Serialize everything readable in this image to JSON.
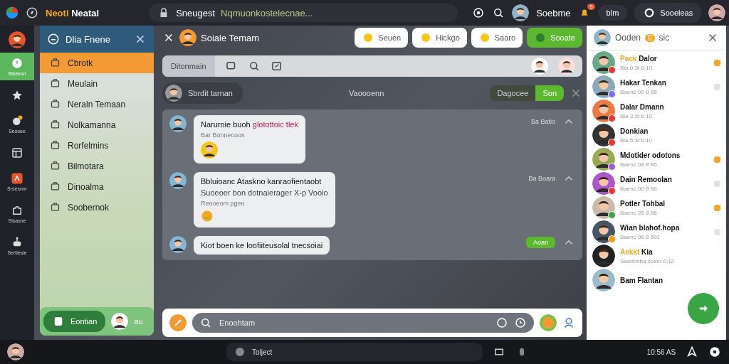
{
  "top_bar": {
    "title_accent": "Neoti",
    "title": "Neatal",
    "search": {
      "label": "Sneugest",
      "value": "Nqmuonkostelecnae..."
    },
    "user": "Soebme",
    "notification_count": "5",
    "pill": "blm",
    "settings": "Sooeleas"
  },
  "rail": {
    "items": [
      {
        "label": "Stsesnn",
        "selected": true
      },
      {
        "selected": false
      },
      {
        "label": "Sesoee",
        "selected": false
      },
      {
        "selected": false
      },
      {
        "label": "Srsesnnr",
        "selected": false
      },
      {
        "label": "Sisasne",
        "selected": false
      },
      {
        "label": "Sertiesie",
        "selected": false
      }
    ]
  },
  "left_panel": {
    "title": "Dlia Fnene",
    "items": [
      {
        "label": "Cbrotk",
        "selected": true
      },
      {
        "label": "Meulain",
        "selected": false
      },
      {
        "label": "Neraln Temaan",
        "selected": false
      },
      {
        "label": "Nolkamanna",
        "selected": false
      },
      {
        "label": "Rorfelmins",
        "selected": false
      },
      {
        "label": "Bilmotara",
        "selected": false
      },
      {
        "label": "Dinoalma",
        "selected": false
      },
      {
        "label": "Soobernok",
        "selected": false
      }
    ],
    "button": "Eontian",
    "user": "au"
  },
  "chat": {
    "title": "Soiale Temam",
    "chips": [
      {
        "label": "Seuen",
        "selected": false
      },
      {
        "label": "Hickgo",
        "selected": false
      },
      {
        "label": "Saaro",
        "selected": false
      },
      {
        "label": "Sooate",
        "selected": true
      }
    ],
    "toolbar_tab": "Ditonmain",
    "filter": {
      "chip": "Sbrdit tarnan",
      "center": "Vaoooenn",
      "options": [
        {
          "label": "Dagocee",
          "selected": false
        },
        {
          "label": "Son",
          "selected": true
        }
      ]
    },
    "messages": [
      {
        "text": "Narurnie buoh",
        "highlight": "glotottoic tlek",
        "meta": "Bar Bonnecoos",
        "time": "Ba Batio",
        "kind": "avatar"
      },
      {
        "text": "Bbluioanc Ataskno kanraofientaobt",
        "line2": "Suoeoer bon dotnaierager X-p Vooio",
        "meta": "Reooeom pgeo",
        "time": "Ba Boara",
        "kind": "emoji"
      },
      {
        "text": "Kiot boen ke loofiiteusolal tnecsoiai",
        "action": "Aoan",
        "kind": "action"
      }
    ],
    "composer": {
      "placeholder": "Enoohtam"
    }
  },
  "contacts_panel": {
    "title": "Ooden",
    "badge": "0",
    "suffix": "sic",
    "contacts": [
      {
        "prefix": "Pack",
        "name": "Dalor",
        "subtitle": "Bia 0:3t 6:10",
        "color": "#e53935",
        "unread": true
      },
      {
        "name": "Hakar Tenkan",
        "subtitle": "Baenc 00 8 86",
        "color": "#7c6ff0",
        "unread": false
      },
      {
        "name": "Dalar Dmann",
        "subtitle": "Bia 3:3t 6:10",
        "color": "#e53935"
      },
      {
        "name": "Donkian",
        "subtitle": "Bia 5:3t 6:10",
        "color": "#e53935"
      },
      {
        "name": "Mdotider odotons",
        "subtitle": "Baenc 08 8 86",
        "color": "#9c5fd0",
        "unread": true
      },
      {
        "name": "Dain Remoolan",
        "subtitle": "Baenc 00 8 86",
        "color": "#e53935",
        "unread": false
      },
      {
        "name": "Potler Tohbal",
        "subtitle": "Baenc 26 8 86",
        "color": "#43a047",
        "unread": true
      },
      {
        "name": "Wian blahof.hopa",
        "subtitle": "Baenc 08 8 501",
        "color": "#f39c12",
        "unread": false
      },
      {
        "prefix": "Aekkt",
        "name": "Kia",
        "subtitle": "Saanbnba spem 0:12"
      },
      {
        "name": "Bam Flantan"
      }
    ]
  },
  "taskbar": {
    "app": "Tolject",
    "time": "10:56 AS"
  }
}
